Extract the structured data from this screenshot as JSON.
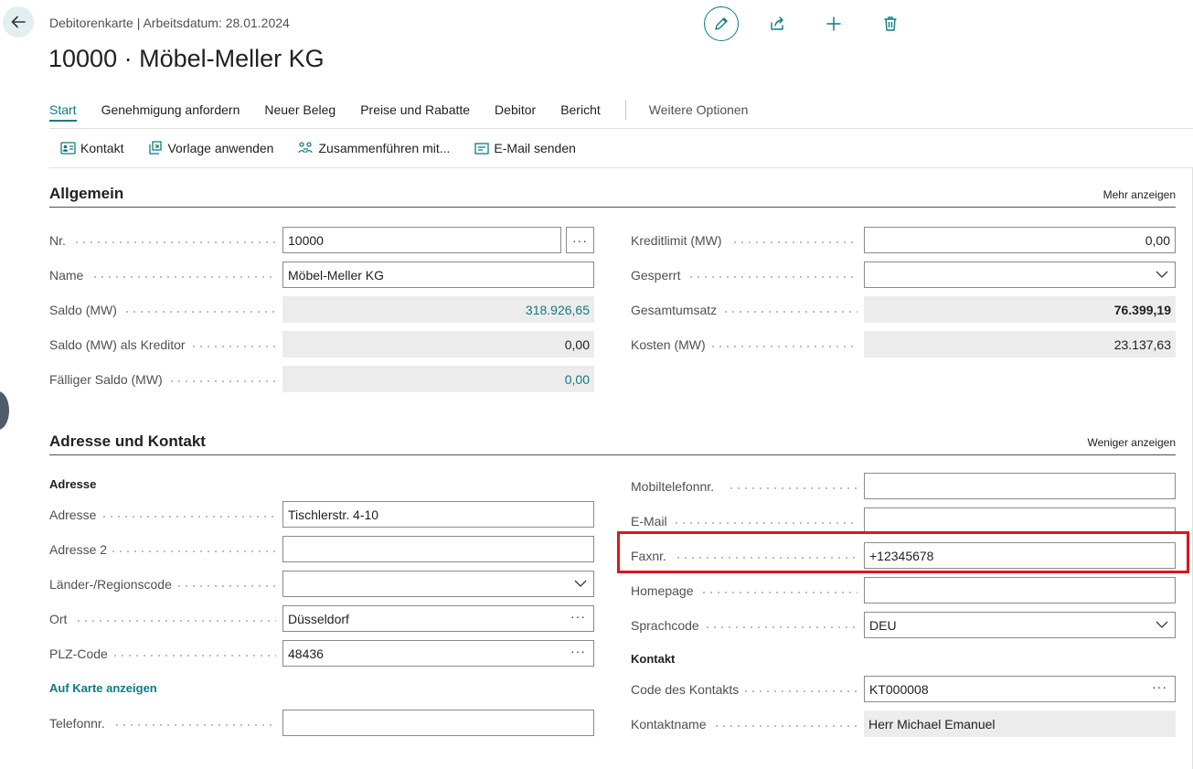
{
  "header": {
    "breadcrumb": "Debitorenkarte | Arbeitsdatum: 28.01.2024",
    "title": "10000 · Möbel-Meller KG"
  },
  "top_actions": [
    "edit-icon",
    "share-icon",
    "plus-icon",
    "delete-icon"
  ],
  "menu": {
    "items": [
      "Start",
      "Genehmigung anfordern",
      "Neuer Beleg",
      "Preise und Rabatte",
      "Debitor",
      "Bericht"
    ],
    "more": "Weitere Optionen",
    "active": "Start"
  },
  "actions": [
    {
      "label": "Kontakt",
      "icon": "contact-card-icon"
    },
    {
      "label": "Vorlage anwenden",
      "icon": "apply-template-icon"
    },
    {
      "label": "Zusammenführen mit...",
      "icon": "merge-icon"
    },
    {
      "label": "E-Mail senden",
      "icon": "email-icon"
    }
  ],
  "general": {
    "title": "Allgemein",
    "link": "Mehr anzeigen",
    "left": [
      {
        "label": "Nr.",
        "value": "10000"
      },
      {
        "label": "Name",
        "value": "Möbel-Meller KG"
      },
      {
        "label": "Saldo (MW)",
        "value": "318.926,65"
      },
      {
        "label": "Saldo (MW) als Kreditor",
        "value": "0,00"
      },
      {
        "label": "Fälliger Saldo (MW)",
        "value": "0,00"
      }
    ],
    "right": [
      {
        "label": "Kreditlimit (MW)",
        "value": "0,00"
      },
      {
        "label": "Gesperrt",
        "value": ""
      },
      {
        "label": "Gesamtumsatz",
        "value": "76.399,19"
      },
      {
        "label": "Kosten (MW)",
        "value": "23.137,63"
      }
    ]
  },
  "address": {
    "title": "Adresse und Kontakt",
    "link": "Weniger anzeigen",
    "subhead_address": "Adresse",
    "left": [
      {
        "label": "Adresse",
        "value": "Tischlerstr. 4-10"
      },
      {
        "label": "Adresse 2",
        "value": ""
      },
      {
        "label": "Länder-/Regionscode",
        "value": ""
      },
      {
        "label": "Ort",
        "value": "Düsseldorf"
      },
      {
        "label": "PLZ-Code",
        "value": "48436"
      }
    ],
    "map_link": "Auf Karte anzeigen",
    "phone": {
      "label": "Telefonnr.",
      "value": ""
    },
    "right": [
      {
        "label": "Mobiltelefonnr.",
        "value": ""
      },
      {
        "label": "E-Mail",
        "value": ""
      },
      {
        "label": "Faxnr.",
        "value": "+12345678"
      },
      {
        "label": "Homepage",
        "value": ""
      },
      {
        "label": "Sprachcode",
        "value": "DEU"
      }
    ],
    "subhead_contact": "Kontakt",
    "contact": [
      {
        "label": "Code des Kontakts",
        "value": "KT000008"
      },
      {
        "label": "Kontaktname",
        "value": "Herr Michael Emanuel"
      }
    ]
  },
  "colors": {
    "accent": "#0f7b83",
    "highlight": "#e0141c",
    "readonly_bg": "#ececec"
  }
}
